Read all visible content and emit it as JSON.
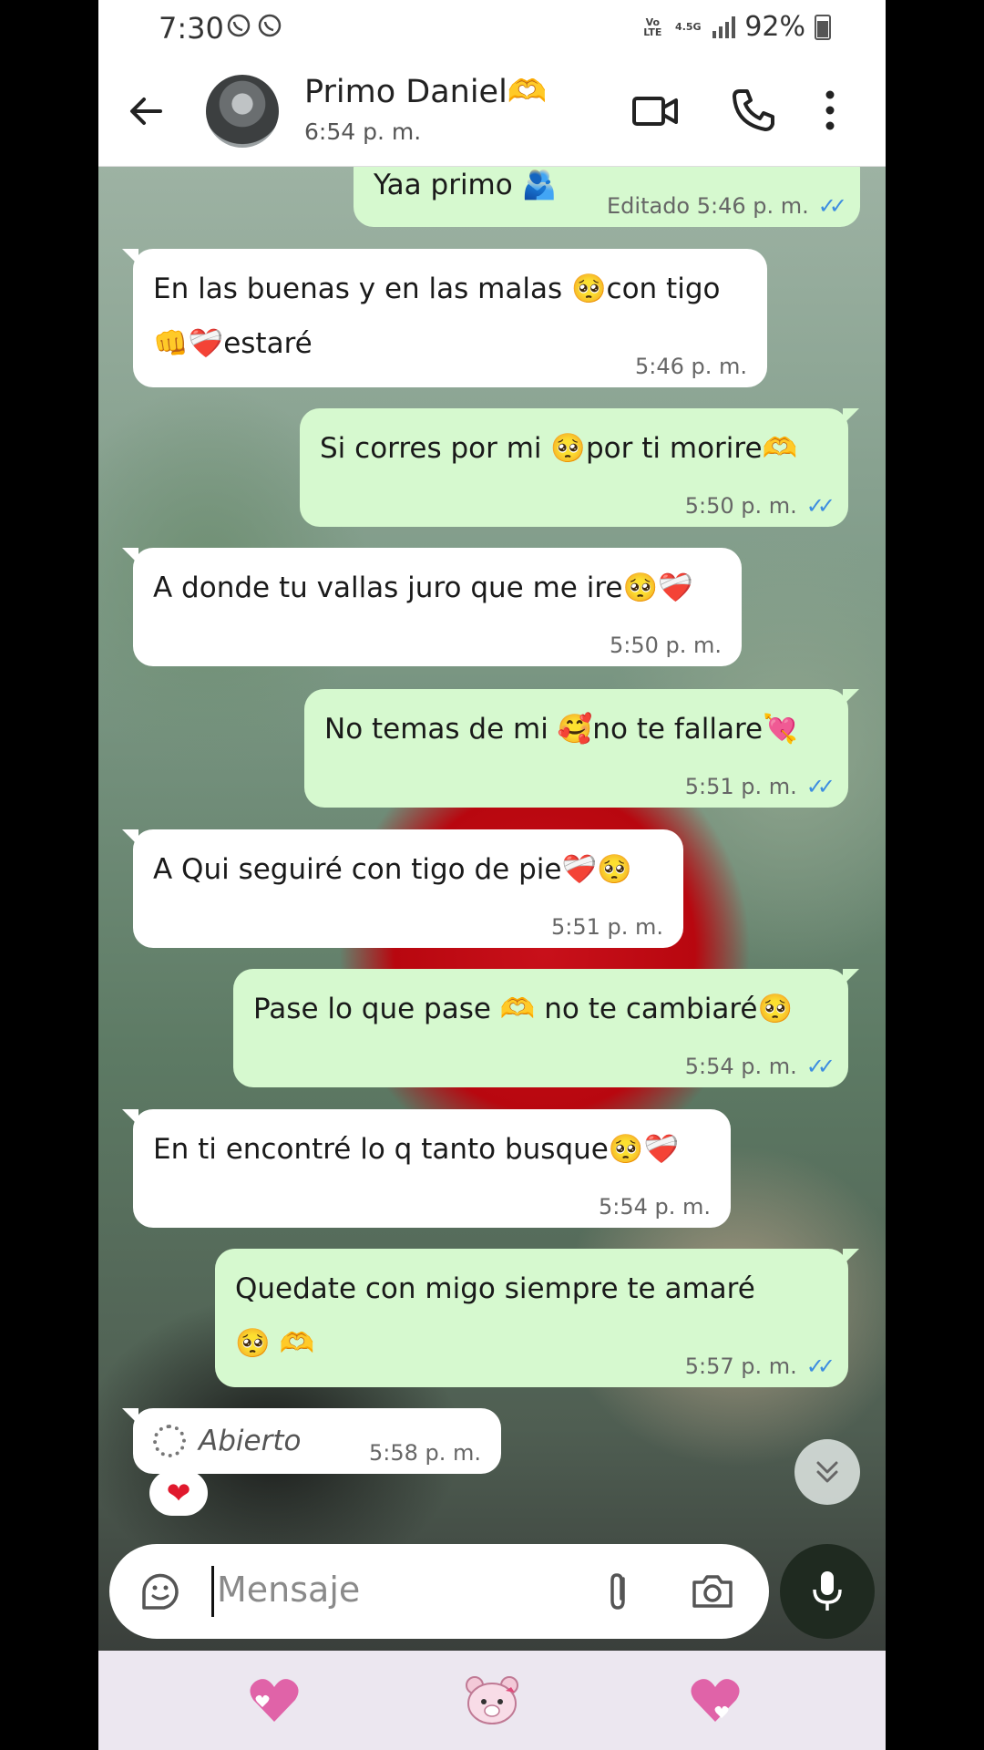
{
  "status_bar": {
    "time": "7:30",
    "network_lte": "Vo LTE",
    "network_type": "4.5G",
    "battery": "92%"
  },
  "header": {
    "contact_name": "Primo Daniel🫶",
    "last_seen": "6:54 p. m."
  },
  "messages": [
    {
      "direction": "out",
      "text": "Yaa primo 🫂",
      "meta": "Editado 5:46 p. m.",
      "ticks": "✓✓"
    },
    {
      "direction": "in",
      "text": "En las buenas y en las malas 🥺con tigo 👊❤️‍🩹estaré",
      "meta": "5:46 p. m."
    },
    {
      "direction": "out",
      "text": "Si corres por mi 🥺por ti morire🫶",
      "meta": "5:50 p. m.",
      "ticks": "✓✓"
    },
    {
      "direction": "in",
      "text": "A donde tu vallas juro que me ire🥺❤️‍🩹",
      "meta": "5:50 p. m."
    },
    {
      "direction": "out",
      "text": "No temas de mi 🥰no te fallare💘",
      "meta": "5:51 p. m.",
      "ticks": "✓✓"
    },
    {
      "direction": "in",
      "text": "A Qui seguiré con tigo de pie❤️‍🩹🥺",
      "meta": "5:51 p. m."
    },
    {
      "direction": "out",
      "text": "Pase lo que pase 🫶 no te cambiaré🥺",
      "meta": "5:54 p. m.",
      "ticks": "✓✓"
    },
    {
      "direction": "in",
      "text": "En ti encontré lo q tanto busque🥺❤️‍🩹",
      "meta": "5:54 p. m."
    },
    {
      "direction": "out",
      "text": "Quedate con migo siempre te amaré 🥺 🫶",
      "meta": "5:57 p. m.",
      "ticks": "✓✓"
    },
    {
      "direction": "in",
      "text": "Abierto",
      "meta": "5:58 p. m.",
      "reaction": "❤"
    }
  ],
  "composer": {
    "placeholder": "Mensaje"
  },
  "icons": {
    "back": "arrow-left-icon",
    "video": "video-camera-icon",
    "call": "phone-icon",
    "menu": "more-vert-icon",
    "sticker": "sticker-icon",
    "attach": "paperclip-icon",
    "camera": "camera-icon",
    "mic": "microphone-icon",
    "scroll": "double-chevron-down-icon"
  },
  "colors": {
    "outgoing_bubble": "#d6f9cf",
    "incoming_bubble": "#ffffff",
    "ticks": "#3d8de0",
    "mic_button": "#1f2a20"
  }
}
